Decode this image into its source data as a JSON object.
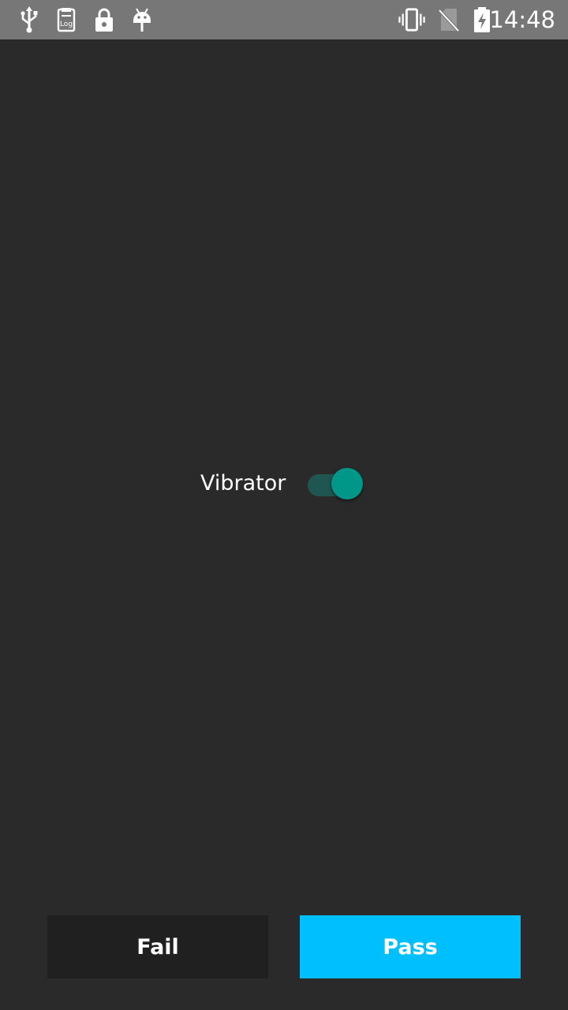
{
  "status_bar": {
    "time": "14:48",
    "left_icons": [
      "usb-icon",
      "log-icon",
      "lock-icon",
      "android-icon"
    ],
    "right_icons": [
      "vibrate-icon",
      "no-sim-icon",
      "battery-charging-icon"
    ]
  },
  "main": {
    "vibrator_label": "Vibrator",
    "vibrator_switch_on": true
  },
  "buttons": {
    "fail_label": "Fail",
    "pass_label": "Pass"
  },
  "colors": {
    "background": "#2a2a2a",
    "status_bar": "#777777",
    "switch_thumb": "#009688",
    "switch_track": "#1f5651",
    "fail_button": "#202020",
    "pass_button": "#00bfff"
  }
}
